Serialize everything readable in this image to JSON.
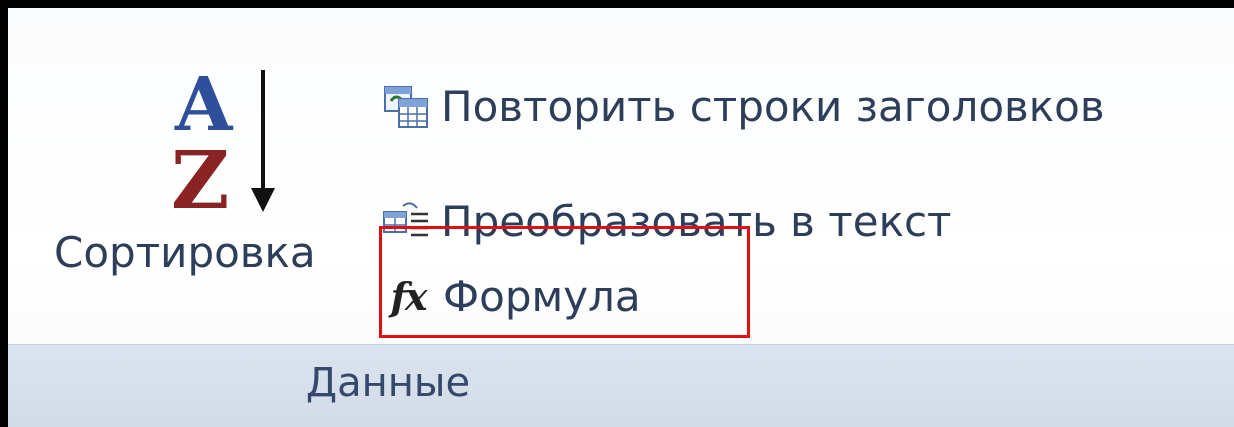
{
  "ribbon": {
    "group_label": "Данные",
    "sort": {
      "label": "Сортировка",
      "icon": "sort-az-icon",
      "letter_top": "A",
      "letter_bottom": "Z"
    },
    "commands": [
      {
        "label": "Повторить строки заголовков",
        "icon": "repeat-header-rows-icon"
      },
      {
        "label": "Преобразовать в текст",
        "icon": "convert-to-text-icon"
      },
      {
        "label": "Формула",
        "icon": "fx-formula-icon",
        "glyph": "fx"
      }
    ],
    "highlight_color": "#e10f10"
  }
}
